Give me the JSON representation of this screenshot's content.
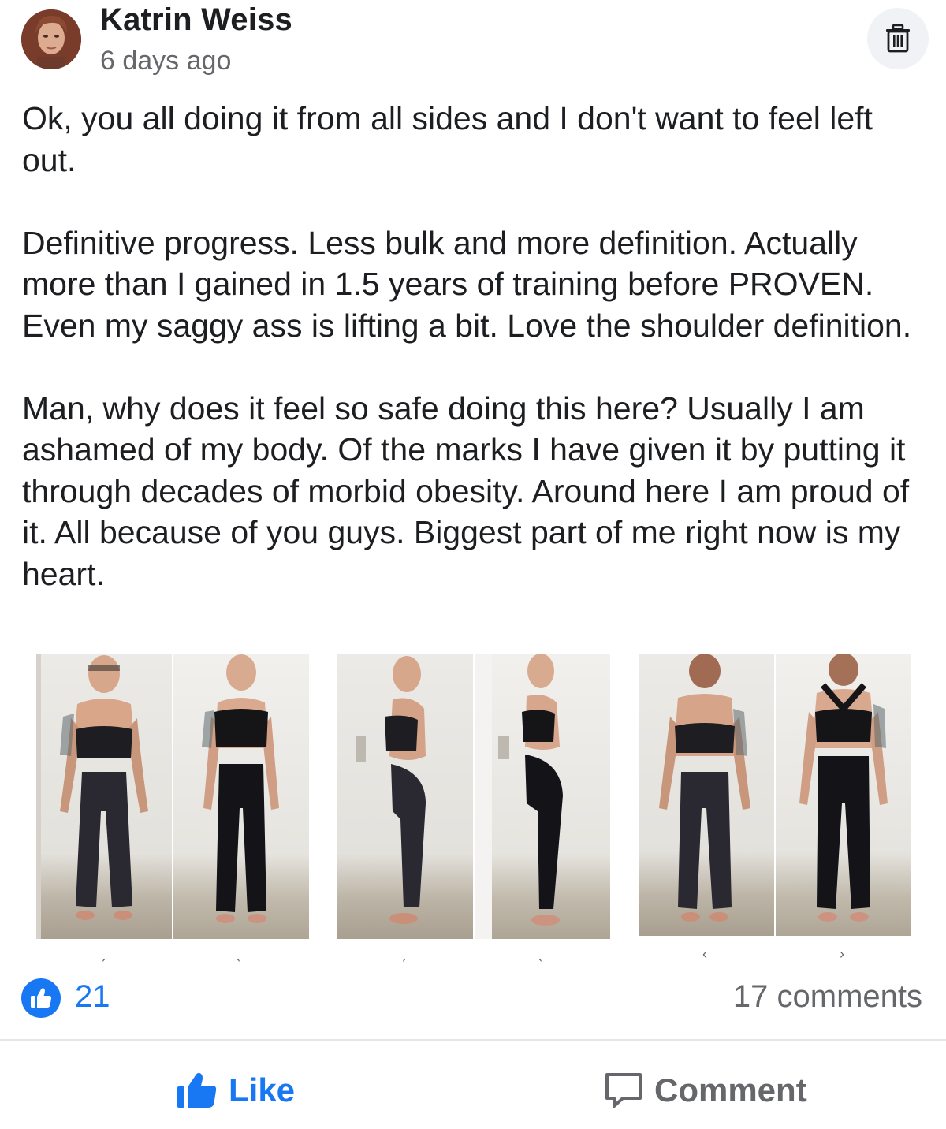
{
  "post": {
    "author": "Katrin Weiss",
    "timestamp": "6 days ago",
    "paragraphs": [
      "Ok, you all doing it from all sides and I don't want to feel left out.",
      "Definitive progress. Less bulk and more definition. Actually more than I gained in 1.5 years of training before PROVEN. Even my saggy ass is lifting a bit. Love the shoulder definition.",
      "Man, why does it feel so safe doing this here? Usually I am ashamed of my body. Of the marks I have given it by putting it through decades of morbid obesity. Around here I am proud of it. All because of you guys. Biggest part of me right now is my heart."
    ],
    "photo_views": [
      "front",
      "side",
      "back"
    ]
  },
  "reactions": {
    "like_count": "21",
    "comments": "17 comments"
  },
  "actions": {
    "like_label": "Like",
    "comment_label": "Comment"
  },
  "icons": {
    "header": "trash-icon",
    "reaction": "thumbs-up-icon",
    "like": "thumbs-up-icon",
    "comment": "speech-bubble-icon"
  },
  "colors": {
    "accent": "#1877f2",
    "secondary_text": "#65676b",
    "primary_text": "#1c1e21",
    "divider": "#e4e6eb"
  }
}
